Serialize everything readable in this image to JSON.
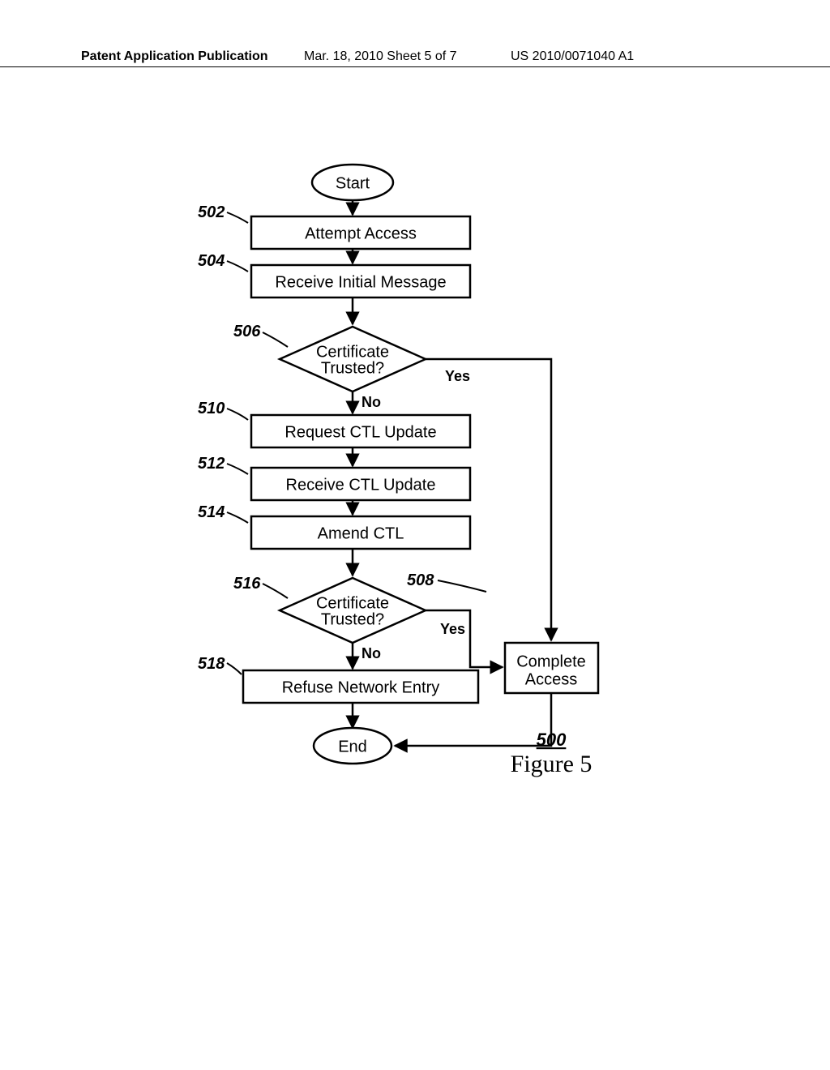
{
  "header": {
    "left": "Patent Application Publication",
    "mid": "Mar. 18, 2010  Sheet 5 of 7",
    "right": "US 2010/0071040 A1"
  },
  "nodes": {
    "start": "Start",
    "n502": "Attempt Access",
    "n504": "Receive Initial Message",
    "n506_line1": "Certificate",
    "n506_line2": "Trusted?",
    "n510": "Request CTL Update",
    "n512": "Receive CTL Update",
    "n514": "Amend CTL",
    "n516_line1": "Certificate",
    "n516_line2": "Trusted?",
    "n518": "Refuse Network Entry",
    "n508_line1": "Complete",
    "n508_line2": "Access",
    "end": "End"
  },
  "refs": {
    "r502": "502",
    "r504": "504",
    "r506": "506",
    "r510": "510",
    "r512": "512",
    "r514": "514",
    "r516": "516",
    "r508": "508",
    "r518": "518",
    "r500": "500"
  },
  "labels": {
    "yes": "Yes",
    "no": "No"
  },
  "figure": {
    "number": "500",
    "label": "Figure 5"
  }
}
